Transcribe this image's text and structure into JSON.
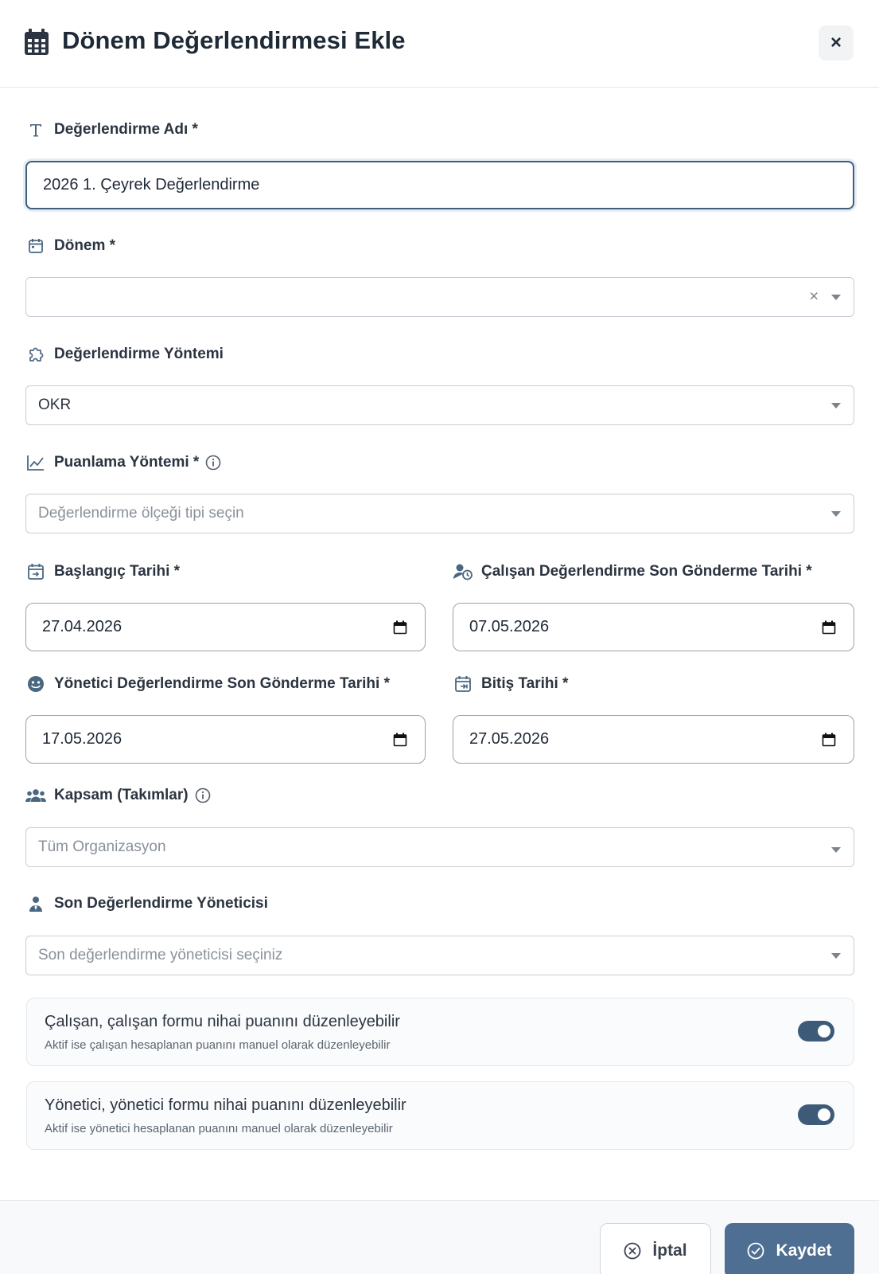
{
  "dialog": {
    "title": "Dönem Değerlendirmesi Ekle",
    "close_label": "×"
  },
  "fields": {
    "name": {
      "label": "Değerlendirme Adı *",
      "value": "2026 1. Çeyrek Değerlendirme"
    },
    "period": {
      "label": "Dönem *",
      "value": ""
    },
    "method": {
      "label": "Değerlendirme Yöntemi",
      "value": "OKR"
    },
    "scoring": {
      "label": "Puanlama Yöntemi *",
      "placeholder": "Değerlendirme ölçeği tipi seçin"
    },
    "start_date": {
      "label": "Başlangıç Tarihi *",
      "value": "27.04.2026"
    },
    "employee_deadline": {
      "label": "Çalışan Değerlendirme Son Gönderme Tarihi *",
      "value": "07.05.2026"
    },
    "manager_deadline": {
      "label": "Yönetici Değerlendirme Son Gönderme Tarihi *",
      "value": "17.05.2026"
    },
    "end_date": {
      "label": "Bitiş Tarihi *",
      "value": "27.05.2026"
    },
    "scope": {
      "label": "Kapsam (Takımlar)",
      "placeholder": "Tüm Organizasyon"
    },
    "final_manager": {
      "label": "Son Değerlendirme Yöneticisi",
      "placeholder": "Son değerlendirme yöneticisi seçiniz"
    }
  },
  "toggles": [
    {
      "title": "Çalışan, çalışan formu nihai puanını düzenleyebilir",
      "subtitle": "Aktif ise çalışan hesaplanan puanını manuel olarak düzenleyebilir",
      "enabled": true
    },
    {
      "title": "Yönetici, yönetici formu nihai puanını düzenleyebilir",
      "subtitle": "Aktif ise yönetici hesaplanan puanını manuel olarak düzenleyebilir",
      "enabled": true
    }
  ],
  "footer": {
    "cancel_label": "İptal",
    "save_label": "Kaydet"
  },
  "colors": {
    "accent": "#4e6f92",
    "icon": "#4a6781",
    "toggle_on": "#3d5a78"
  }
}
